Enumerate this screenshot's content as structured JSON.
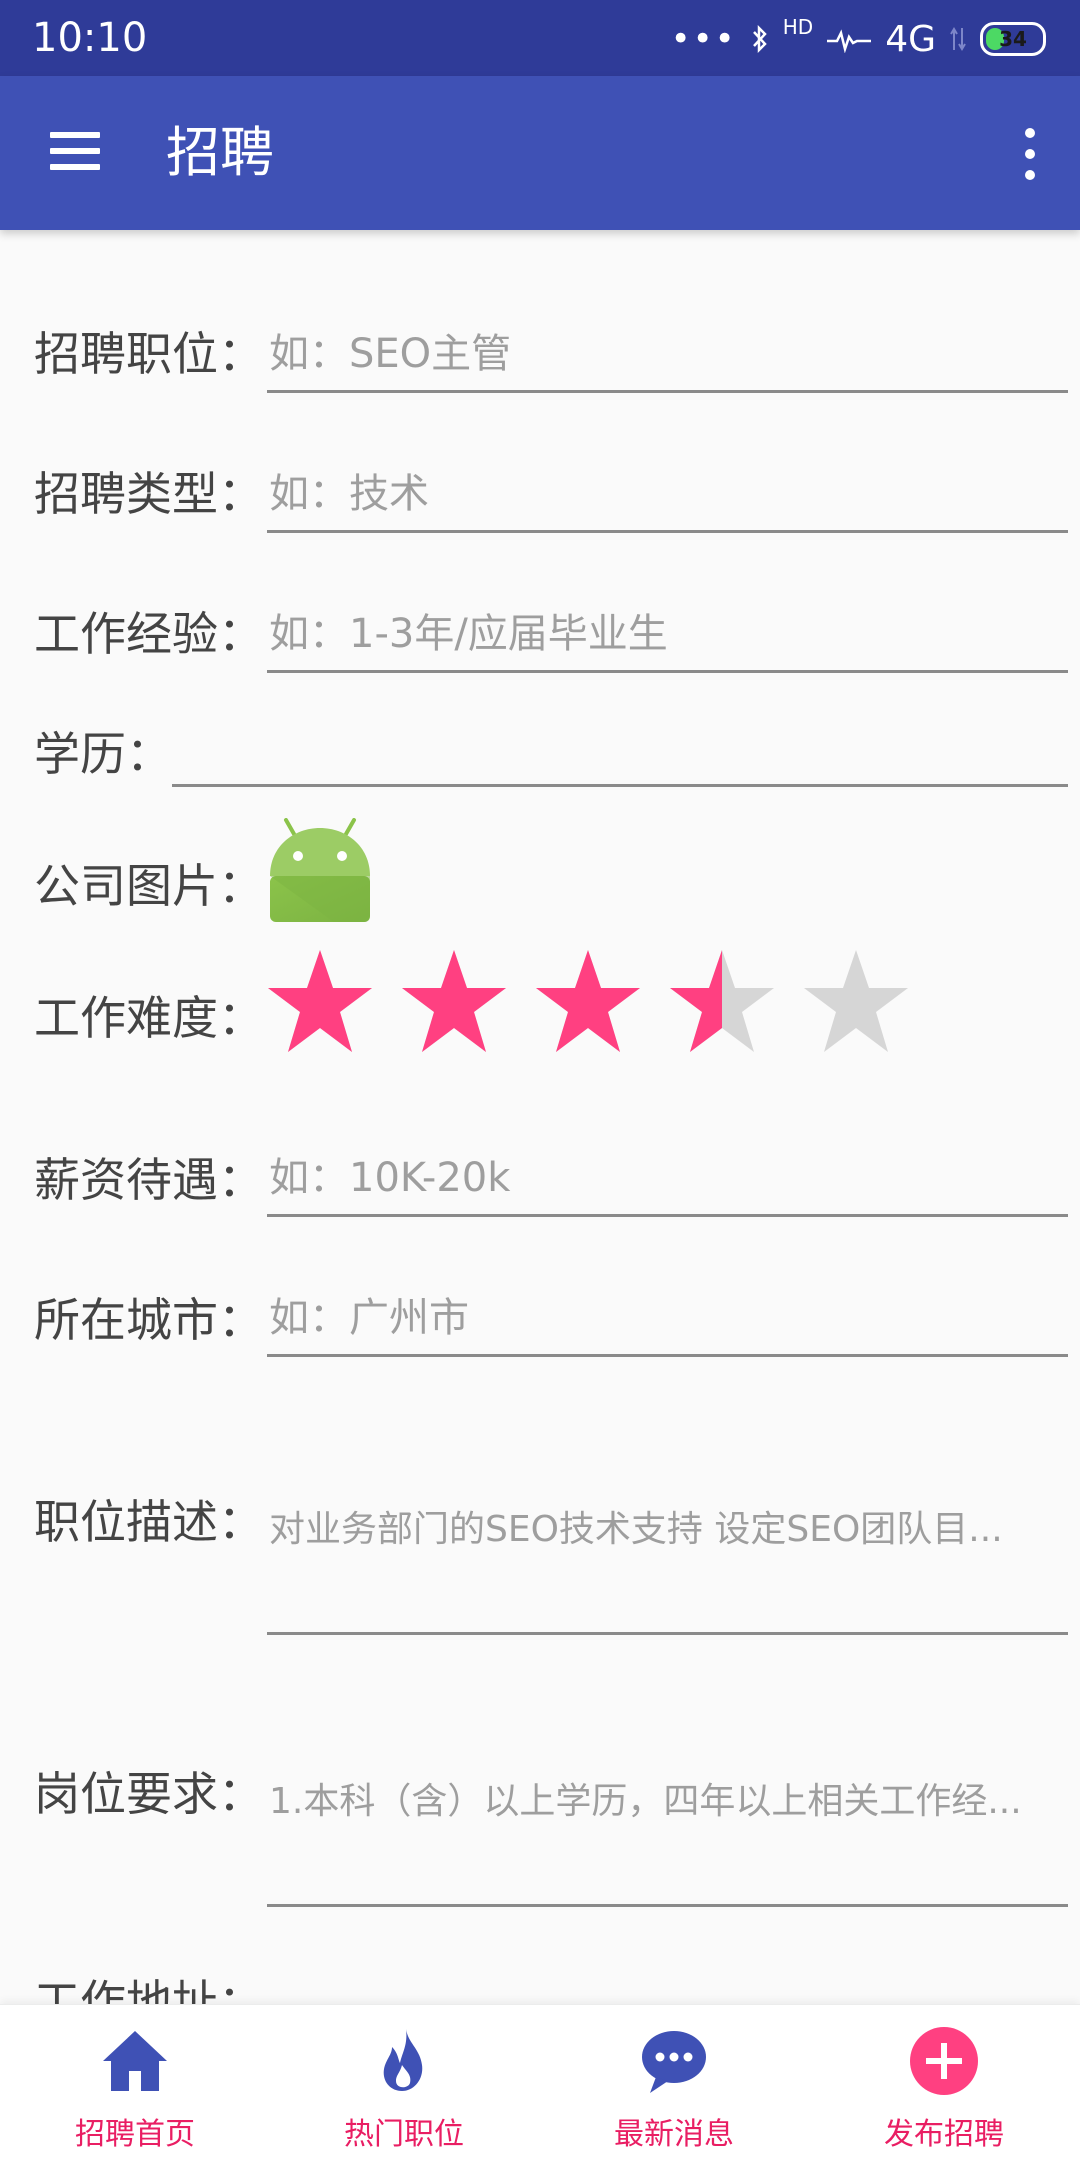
{
  "status_bar": {
    "time": "10:10",
    "dots": "•••",
    "hd": "HD",
    "network": "4G",
    "battery": "34",
    "battery_level": 0.34
  },
  "app_bar": {
    "title": "招聘"
  },
  "form": {
    "position_label": "招聘职位：",
    "position_placeholder": "如：SEO主管",
    "type_label": "招聘类型：",
    "type_placeholder": "如：技术",
    "experience_label": "工作经验：",
    "experience_placeholder": "如：1-3年/应届毕业生",
    "education_label": "学历：",
    "education_value": "",
    "company_image_label": "公司图片：",
    "difficulty_label": "工作难度：",
    "difficulty_rating": 3.5,
    "difficulty_max": 5,
    "salary_label": "薪资待遇：",
    "salary_placeholder": "如：10K-20k",
    "city_label": "所在城市：",
    "city_placeholder": "如：广州市",
    "description_label": "职位描述：",
    "description_text": "对业务部门的SEO技术支持 设定SEO团队目...",
    "requirements_label": "岗位要求：",
    "requirements_text": "1.本科（含）以上学历，四年以上相关工作经...",
    "address_label": "工作地址："
  },
  "colors": {
    "status_bar": "#2f3b98",
    "app_bar": "#3f51b5",
    "star_filled": "#ff4081",
    "star_empty": "#d6d6d6",
    "nav_label": "#e91e63",
    "nav_icon_blue": "#3f51b5"
  },
  "bottom_nav": {
    "items": [
      {
        "label": "招聘首页",
        "icon": "home-icon"
      },
      {
        "label": "热门职位",
        "icon": "fire-icon"
      },
      {
        "label": "最新消息",
        "icon": "chat-icon"
      },
      {
        "label": "发布招聘",
        "icon": "add-icon"
      }
    ]
  }
}
